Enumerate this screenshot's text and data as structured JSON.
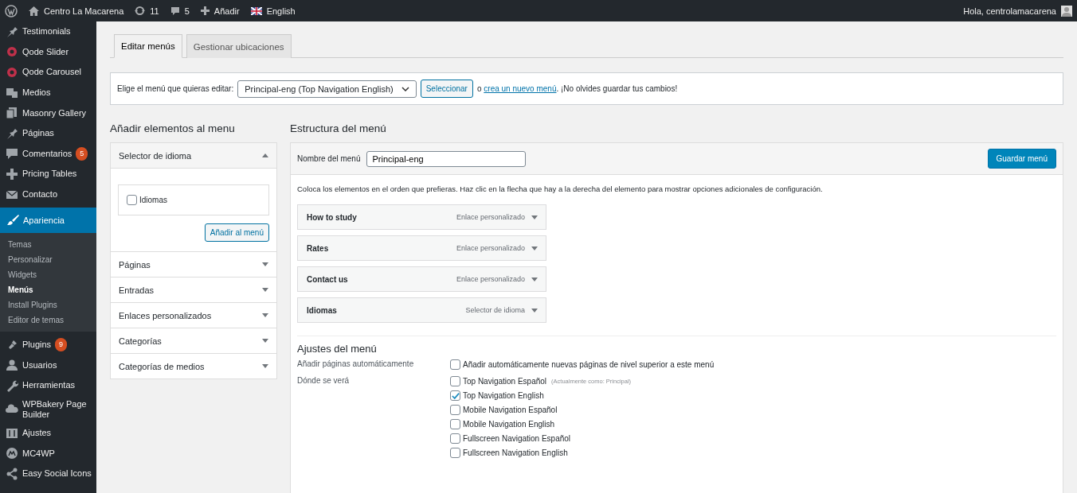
{
  "admin_bar": {
    "site": "Centro La Macarena",
    "updates": "11",
    "comments": "5",
    "new": "Añadir",
    "language": "English",
    "greeting": "Hola, centrolamacarena"
  },
  "sidebar": {
    "items": [
      {
        "label": "Testimonials",
        "selected": false
      },
      {
        "label": "Qode Slider",
        "selected": false
      },
      {
        "label": "Qode Carousel",
        "selected": false
      },
      {
        "label": "Medios",
        "selected": false
      },
      {
        "label": "Masonry Gallery",
        "selected": false
      },
      {
        "label": "Páginas",
        "selected": false
      },
      {
        "label": "Comentarios",
        "badge": "5",
        "selected": false
      },
      {
        "label": "Pricing Tables",
        "selected": false
      },
      {
        "label": "Contacto",
        "selected": false
      },
      {
        "label": "Apariencia",
        "selected": true,
        "children": [
          {
            "label": "Temas",
            "selected": false
          },
          {
            "label": "Personalizar",
            "selected": false
          },
          {
            "label": "Widgets",
            "selected": false
          },
          {
            "label": "Menús",
            "selected": true
          },
          {
            "label": "Install Plugins",
            "selected": false
          },
          {
            "label": "Editor de temas",
            "selected": false
          }
        ]
      },
      {
        "label": "Plugins",
        "badge": "9",
        "selected": false
      },
      {
        "label": "Usuarios",
        "selected": false
      },
      {
        "label": "Herramientas",
        "selected": false
      },
      {
        "label": "WPBakery Page Builder",
        "selected": false
      },
      {
        "label": "Ajustes",
        "selected": false
      },
      {
        "label": "MC4WP",
        "selected": false
      },
      {
        "label": "Easy Social Icons",
        "selected": false
      }
    ]
  },
  "tabs": [
    {
      "label": "Editar menús",
      "selected": true
    },
    {
      "label": "Gestionar ubicaciones",
      "selected": false
    }
  ],
  "menu_select": {
    "label": "Elige el menú que quieras editar:",
    "value": "Principal-eng (Top Navigation English)",
    "button": "Seleccionar",
    "prefix": "o",
    "link": "crea un nuevo menú",
    "suffix": ". ¡No olvides guardar tus cambios!"
  },
  "add_items": {
    "heading": "Añadir elementos al menu",
    "sections": [
      {
        "title": "Selector de idioma",
        "expanded": true,
        "options": [
          {
            "label": "Idiomas",
            "checked": false
          }
        ],
        "button": "Añadir al menú"
      },
      {
        "title": "Páginas",
        "expanded": false
      },
      {
        "title": "Entradas",
        "expanded": false
      },
      {
        "title": "Enlaces personalizados",
        "expanded": false
      },
      {
        "title": "Categorías",
        "expanded": false
      },
      {
        "title": "Categorías de medios",
        "expanded": false
      }
    ]
  },
  "structure": {
    "heading": "Estructura del menú",
    "name_label": "Nombre del menú",
    "name_value": "Principal-eng",
    "save_button": "Guardar menú",
    "instructions": "Coloca los elementos en el orden que prefieras. Haz clic en la flecha que hay a la derecha del elemento para mostrar opciones adicionales de configuración.",
    "items": [
      {
        "title": "How to study",
        "type": "Enlace personalizado"
      },
      {
        "title": "Rates",
        "type": "Enlace personalizado"
      },
      {
        "title": "Contact us",
        "type": "Enlace personalizado"
      },
      {
        "title": "Idiomas",
        "type": "Selector de idioma"
      }
    ],
    "settings": {
      "heading": "Ajustes del menú",
      "groups": [
        {
          "label": "Añadir páginas automáticamente",
          "options": [
            {
              "label": "Añadir automáticamente nuevas páginas de nivel superior a este menú",
              "checked": false
            }
          ]
        },
        {
          "label": "Dónde se verá",
          "options": [
            {
              "label": "Top Navigation Español",
              "note": "(Actualmente como: Principal)",
              "checked": false
            },
            {
              "label": "Top Navigation English",
              "checked": true
            },
            {
              "label": "Mobile Navigation Español",
              "checked": false
            },
            {
              "label": "Mobile Navigation English",
              "checked": false
            },
            {
              "label": "Fullscreen Navigation Español",
              "checked": false
            },
            {
              "label": "Fullscreen Navigation English",
              "checked": false
            }
          ]
        }
      ]
    }
  }
}
